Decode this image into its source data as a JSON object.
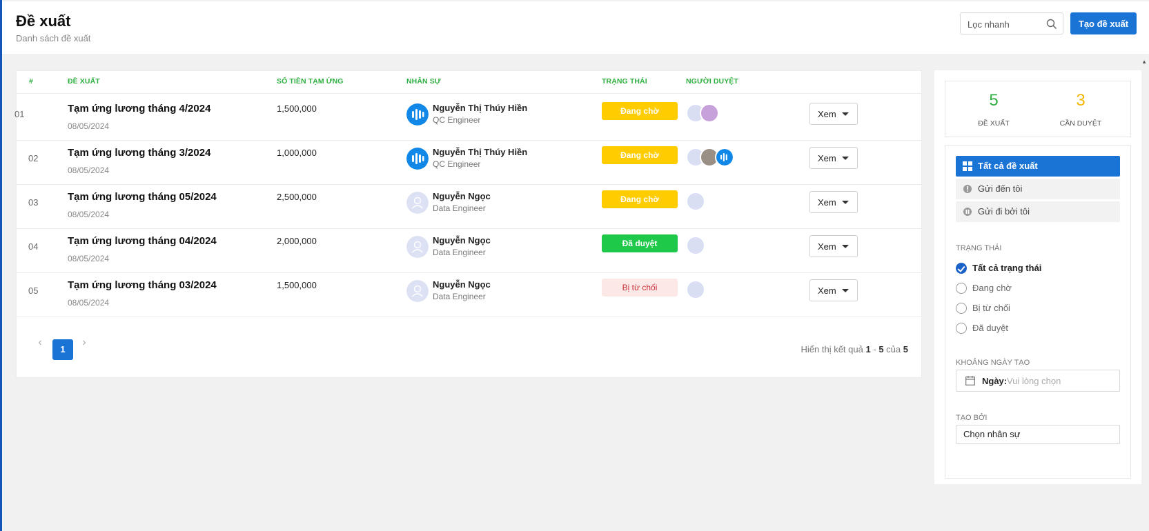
{
  "header": {
    "title": "Đề xuất",
    "subtitle": "Danh sách đề xuất",
    "search_placeholder": "Lọc nhanh",
    "create_label": "Tạo đề xuất"
  },
  "table": {
    "columns": [
      "#",
      "Đề xuất",
      "Số tiền tạm ứng",
      "Nhân sự",
      "Trạng thái",
      "Người duyệt"
    ],
    "view_label": "Xem",
    "rows": [
      {
        "no": "01",
        "title": "Tạm ứng lương tháng 4/2024",
        "date": "08/05/2024",
        "amount": "1,500,000",
        "name": "Nguyễn Thị Thúy Hiền",
        "role": "QC Engineer",
        "status": "Đang chờ"
      },
      {
        "no": "02",
        "title": "Tạm ứng lương tháng 3/2024",
        "date": "08/05/2024",
        "amount": "1,000,000",
        "name": "Nguyễn Thị Thúy Hiền",
        "role": "QC Engineer",
        "status": "Đang chờ"
      },
      {
        "no": "03",
        "title": "Tạm ứng lương tháng 05/2024",
        "date": "08/05/2024",
        "amount": "2,500,000",
        "name": "Nguyễn Ngọc",
        "role": "Data Engineer",
        "status": "Đang chờ"
      },
      {
        "no": "04",
        "title": "Tạm ứng lương tháng 04/2024",
        "date": "08/05/2024",
        "amount": "2,000,000",
        "name": "Nguyễn Ngọc",
        "role": "Data Engineer",
        "status": "Đã duyệt"
      },
      {
        "no": "05",
        "title": "Tạm ứng lương tháng 03/2024",
        "date": "08/05/2024",
        "amount": "1,500,000",
        "name": "Nguyễn Ngọc",
        "role": "Data Engineer",
        "status": "Bị từ chối"
      }
    ]
  },
  "pagination": {
    "prev": "‹",
    "current_page": "1",
    "next": "›",
    "info_prefix": "Hiển thị kết quả",
    "from": "1",
    "sep": "-",
    "to": "5",
    "of_word": "của",
    "total": "5"
  },
  "sidebar": {
    "stats": [
      {
        "value": "5",
        "label": "Đề xuất",
        "color": "#2fae41"
      },
      {
        "value": "3",
        "label": "Cần duyệt",
        "color": "#f2b705"
      }
    ],
    "filters": [
      {
        "label": "Tất cả đề xuất",
        "icon": "grid-icon",
        "active": true
      },
      {
        "label": "Gửi đến tôi",
        "icon": "alert-icon",
        "active": false
      },
      {
        "label": "Gửi đi bởi tôi",
        "icon": "pause-icon",
        "active": false
      }
    ],
    "status_title": "Trạng thái",
    "status_options": [
      "Tất cả trạng thái",
      "Đang chờ",
      "Bị từ chối",
      "Đã duyệt"
    ],
    "date_title": "Khoảng ngày tạo",
    "date_label": "Ngày:",
    "date_placeholder": "Vui lòng chọn",
    "created_by_title": "Tạo bởi",
    "created_by_placeholder": "Chọn nhân sự"
  },
  "colors": {
    "accent": "#1a74d6",
    "header_green": "#2fae41",
    "pending": "#ffcc00",
    "approved": "#1ec94a",
    "rejected_bg": "#fde8e8"
  }
}
